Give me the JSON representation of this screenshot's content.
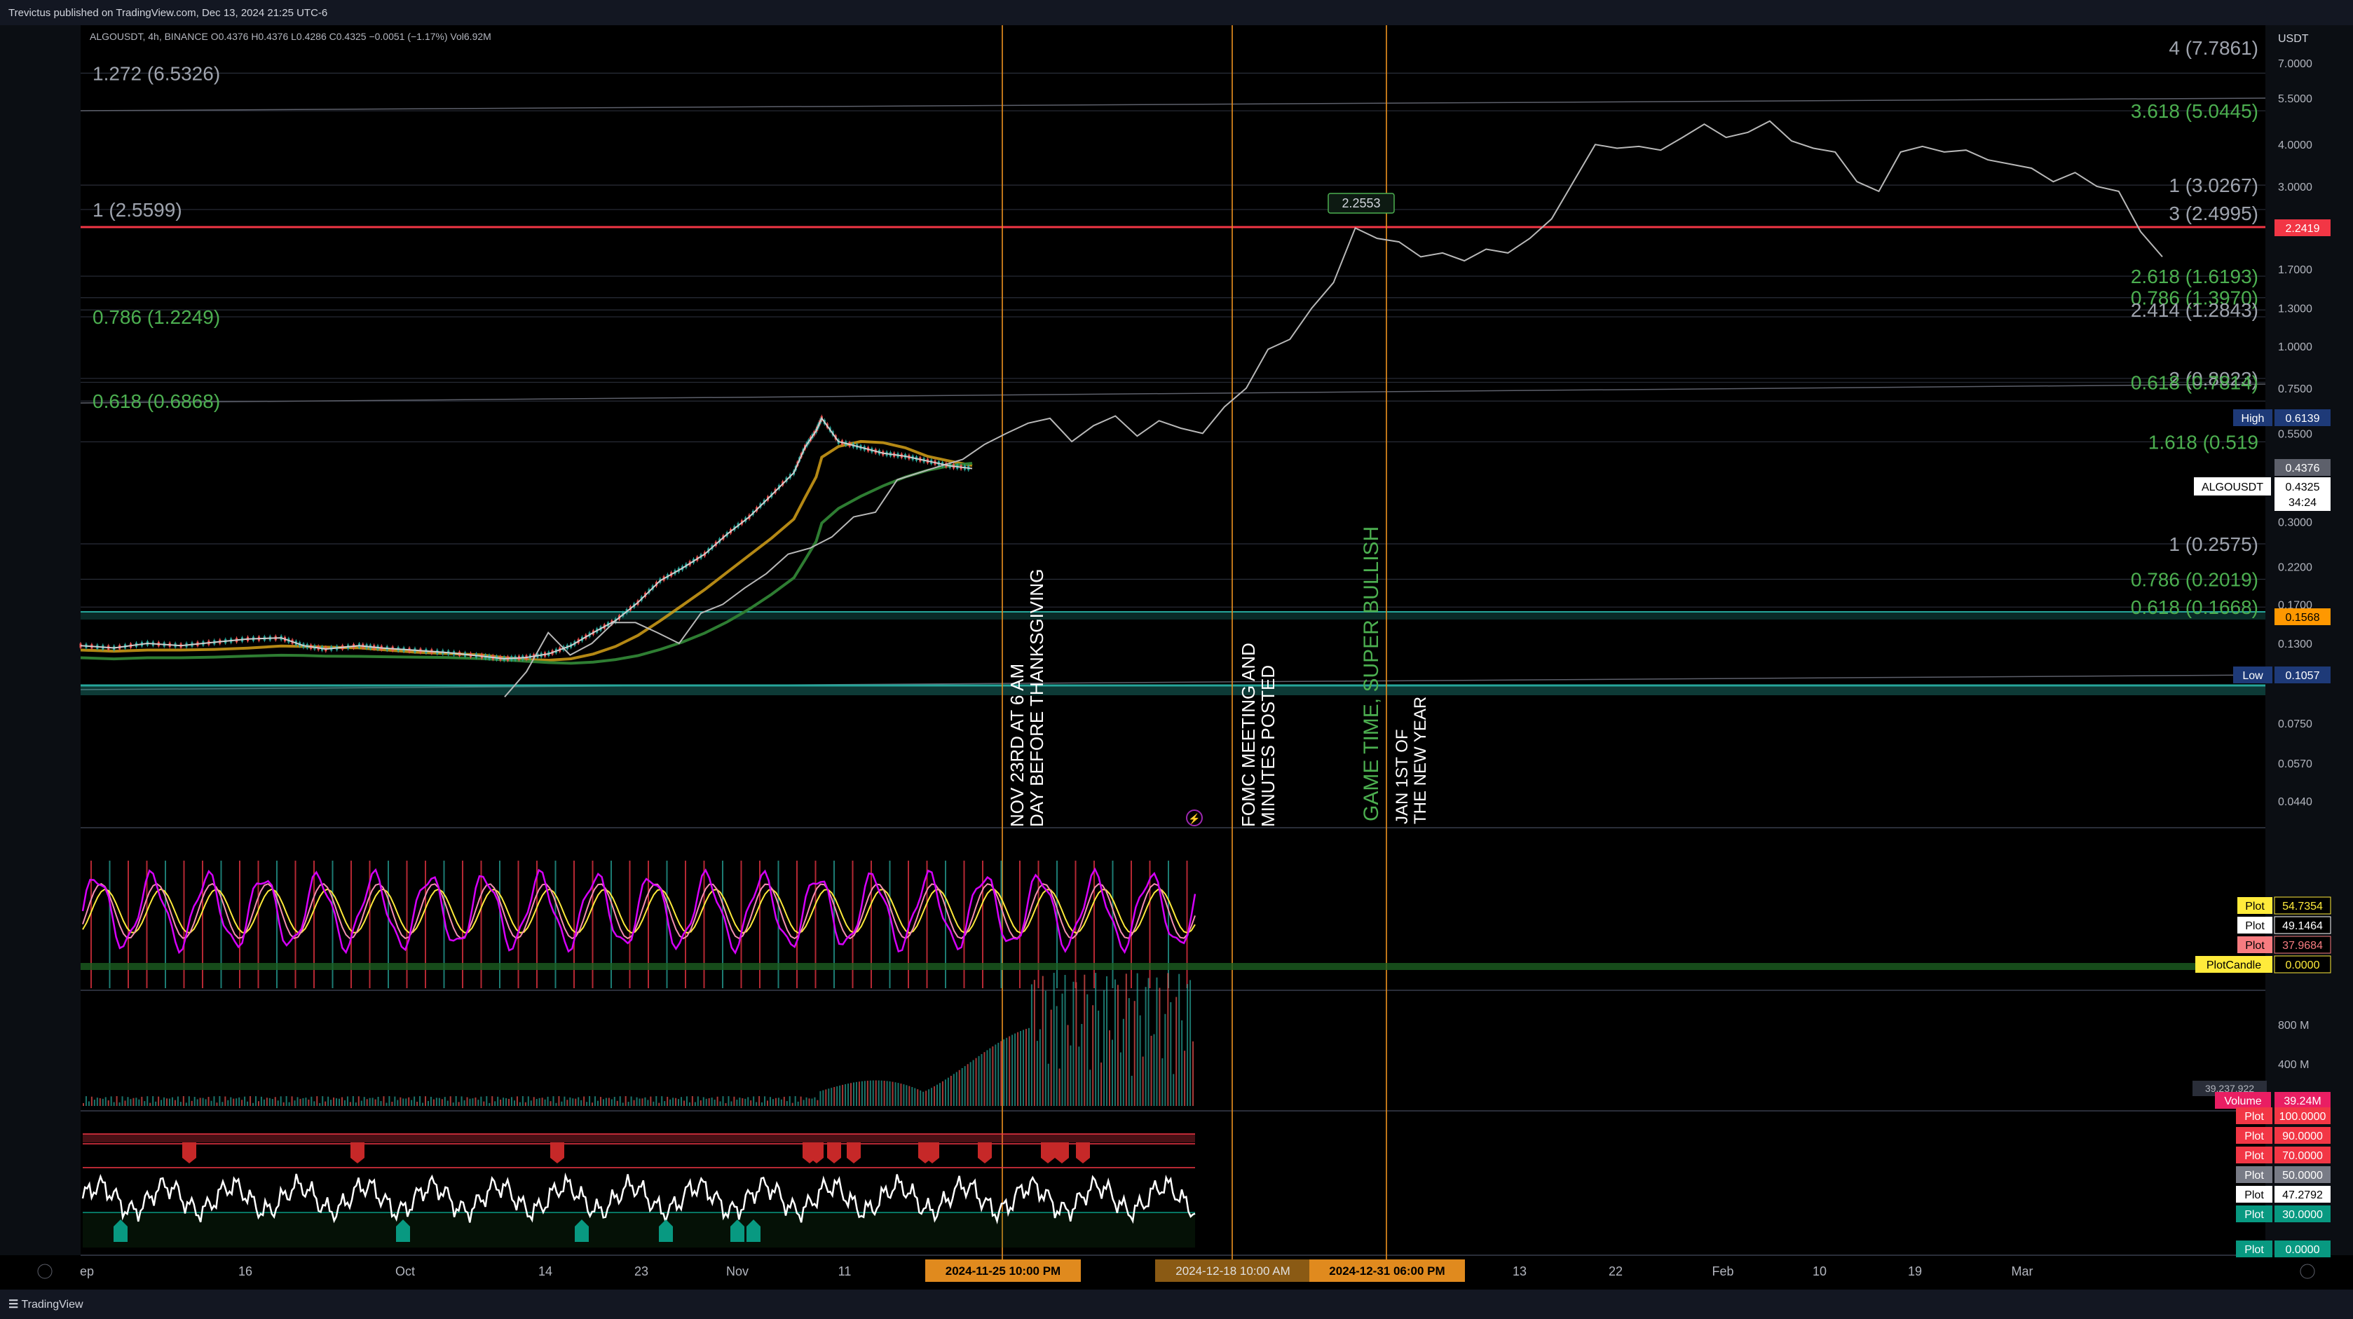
{
  "header": {
    "publisher": "Trevictus published on TradingView.com, Dec 13, 2024 21:25 UTC-6",
    "legend": "ALGOUSDT, 4h, BINANCE  O0.4376  H0.4376  L0.4286  C0.4325  −0.0051 (−1.17%)  Vol6.92M"
  },
  "footer": {
    "brand": "TradingView"
  },
  "colors": {
    "background": "#000000",
    "price_line": "#b8b8b8",
    "fib_green": "#4caf50",
    "fib_gray": "#9ea3ad",
    "resistance_red": "#f23645",
    "support_teal": "#26a69a",
    "event_line": "#e08a1e",
    "ma_yellow": "#d4a017",
    "ma_green": "#2e7d32"
  },
  "annotations": {
    "thanksgiving": [
      "NOV 23RD AT 6 AM",
      "DAY BEFORE THANKSGIVING"
    ],
    "fomc": [
      "FOMC MEETING AND",
      "MINUTES POSTED"
    ],
    "game_time": "GAME TIME, SUPER BULLISH",
    "new_year": [
      "JAN 1ST OF",
      "THE NEW YEAR"
    ],
    "peak_label": "2.2553"
  },
  "fib_labels_left": [
    {
      "text": "1.272 (6.5326)",
      "color": "gray",
      "price": 6.5326
    },
    {
      "text": "1 (2.5599)",
      "color": "gray",
      "price": 2.5599
    },
    {
      "text": "0.786 (1.2249)",
      "color": "green",
      "price": 1.2249
    },
    {
      "text": "0.618 (0.6868)",
      "color": "green",
      "price": 0.6868
    }
  ],
  "fib_labels_right": [
    {
      "text": "4 (7.7861)",
      "color": "gray",
      "price": 7.7861
    },
    {
      "text": "3.618 (5.0445)",
      "color": "green",
      "price": 5.0445
    },
    {
      "text": "1 (3.0267)",
      "color": "gray",
      "price": 3.0267
    },
    {
      "text": "3 (2.4995)",
      "color": "gray",
      "price": 2.4995
    },
    {
      "text": "2.618 (1.6193)",
      "color": "green",
      "price": 1.6193
    },
    {
      "text": "0.786 (1.3970)",
      "color": "green",
      "price": 1.397
    },
    {
      "text": "2.414 (1.2843)",
      "color": "gray",
      "price": 1.2843
    },
    {
      "text": "2 (0.8023)",
      "color": "gray",
      "price": 0.8023
    },
    {
      "text": "0.618 (0.7814)",
      "color": "green",
      "price": 0.7814
    },
    {
      "text": "1.618 (0.519",
      "color": "green",
      "price": 0.519
    },
    {
      "text": "1 (0.2575)",
      "color": "gray",
      "price": 0.2575
    },
    {
      "text": "0.786 (0.2019)",
      "color": "green",
      "price": 0.2019
    },
    {
      "text": "0.618 (0.1668)",
      "color": "green",
      "price": 0.1668
    }
  ],
  "price_axis": {
    "currency": "USDT",
    "ticks": [
      "7.0000",
      "5.5000",
      "4.0000",
      "3.0000",
      "2.2419",
      "1.7000",
      "1.3000",
      "1.0000",
      "0.7500",
      "0.5500",
      "0.4376",
      "0.3000",
      "0.2200",
      "0.1700",
      "0.1568",
      "0.1300",
      "0.1057",
      "0.0750",
      "0.0570",
      "0.0440"
    ],
    "tick_values": [
      7.0,
      5.5,
      4.0,
      3.0,
      2.2419,
      1.7,
      1.3,
      1.0,
      0.75,
      0.55,
      0.4376,
      0.3,
      0.22,
      0.17,
      0.1568,
      0.13,
      0.1057,
      0.075,
      0.057,
      0.044
    ],
    "badges": {
      "resistance": "2.2419",
      "high_label": "High",
      "high_value": "0.6139",
      "last": "0.4376",
      "symbol": "ALGOUSDT",
      "symbol_price": "0.4325",
      "countdown": "34:24",
      "support": "0.1568",
      "low_label": "Low",
      "low_value": "0.1057"
    }
  },
  "time_axis": {
    "ticks": [
      "ep",
      "16",
      "Oct",
      "14",
      "23",
      "Nov",
      "11",
      "13",
      "22",
      "Feb",
      "10",
      "19",
      "Mar"
    ],
    "highlight_1": "2024-11-25   10:00 PM",
    "highlight_2": "2024-12-18   10:00 AM",
    "highlight_3": "2024-12-31   06:00 PM"
  },
  "osc_axis": {
    "badges": [
      {
        "label": "Plot",
        "value": "54.7354",
        "color": "#ffeb3b"
      },
      {
        "label": "Plot",
        "value": "49.1464",
        "color": "#ffffff"
      },
      {
        "label": "Plot",
        "value": "37.9684",
        "color": "#f77c80"
      },
      {
        "label": "PlotCandle",
        "value": "0.0000",
        "color": "#ffeb3b"
      }
    ]
  },
  "volume_axis": {
    "ticks": [
      "800 M",
      "400 M"
    ],
    "badge_label": "Volume",
    "badge_value": "39.24M",
    "faint_value": "39.237.922"
  },
  "rsi_axis": {
    "badges": [
      {
        "label": "Plot",
        "value": "100.0000",
        "color": "#f23645"
      },
      {
        "label": "Plot",
        "value": "90.0000",
        "color": "#f23645"
      },
      {
        "label": "Plot",
        "value": "70.0000",
        "color": "#f23645"
      },
      {
        "label": "Plot",
        "value": "50.0000",
        "color": "#787b86"
      },
      {
        "label": "Plot",
        "value": "47.2792",
        "color": "#ffffff"
      },
      {
        "label": "Plot",
        "value": "30.0000",
        "color": "#089981"
      },
      {
        "label": "Plot",
        "value": "0.0000",
        "color": "#089981"
      }
    ]
  },
  "chart_data": {
    "type": "line",
    "symbol": "ALGOUSDT",
    "interval": "4h",
    "scale": "log",
    "ylim": [
      0.044,
      7.0
    ],
    "grid": false,
    "series": [
      {
        "name": "ALGOUSDT",
        "points": [
          [
            0,
            0.128
          ],
          [
            0.03,
            0.126
          ],
          [
            0.06,
            0.13
          ],
          [
            0.09,
            0.128
          ],
          [
            0.12,
            0.131
          ],
          [
            0.15,
            0.134
          ],
          [
            0.18,
            0.135
          ],
          [
            0.2,
            0.128
          ],
          [
            0.22,
            0.125
          ],
          [
            0.25,
            0.128
          ],
          [
            0.27,
            0.126
          ],
          [
            0.3,
            0.124
          ],
          [
            0.33,
            0.122
          ],
          [
            0.36,
            0.119
          ],
          [
            0.38,
            0.117
          ],
          [
            0.4,
            0.118
          ],
          [
            0.42,
            0.121
          ],
          [
            0.44,
            0.128
          ],
          [
            0.46,
            0.14
          ],
          [
            0.48,
            0.152
          ],
          [
            0.5,
            0.172
          ],
          [
            0.52,
            0.2
          ],
          [
            0.54,
            0.218
          ],
          [
            0.56,
            0.24
          ],
          [
            0.58,
            0.275
          ],
          [
            0.6,
            0.31
          ],
          [
            0.62,
            0.36
          ],
          [
            0.64,
            0.42
          ],
          [
            0.65,
            0.5
          ],
          [
            0.66,
            0.56
          ],
          [
            0.665,
            0.61
          ],
          [
            0.68,
            0.52
          ],
          [
            0.7,
            0.5
          ],
          [
            0.72,
            0.48
          ],
          [
            0.74,
            0.47
          ],
          [
            0.76,
            0.455
          ],
          [
            0.78,
            0.44
          ],
          [
            0.8,
            0.432
          ]
        ]
      }
    ],
    "projection": [
      0.09,
      0.107,
      0.14,
      0.12,
      0.13,
      0.15,
      0.15,
      0.14,
      0.13,
      0.16,
      0.17,
      0.19,
      0.21,
      0.24,
      0.25,
      0.27,
      0.31,
      0.32,
      0.4,
      0.42,
      0.44,
      0.46,
      0.51,
      0.55,
      0.59,
      0.61,
      0.52,
      0.58,
      0.62,
      0.54,
      0.6,
      0.57,
      0.55,
      0.66,
      0.75,
      0.98,
      1.05,
      1.3,
      1.55,
      2.2553,
      2.1,
      2.05,
      1.85,
      1.9,
      1.8,
      1.95,
      1.9,
      2.1,
      2.4,
      3.1,
      4.0,
      3.9,
      3.95,
      3.85,
      4.2,
      4.6,
      4.2,
      4.35,
      4.7,
      4.1,
      3.9,
      3.8,
      3.1,
      2.9,
      3.8,
      3.95,
      3.8,
      3.85,
      3.6,
      3.5,
      3.4,
      3.1,
      3.3,
      3.0,
      2.9,
      2.2,
      1.85
    ]
  }
}
